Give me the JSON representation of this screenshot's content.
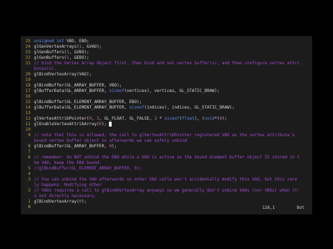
{
  "editor": {
    "lines": [
      {
        "n": "25",
        "t": "unsigned int VBO, EBO;",
        "cls": "code"
      },
      {
        "n": "24",
        "t": "glGenVertexArrays(1, &VAO);",
        "cls": "code"
      },
      {
        "n": "23",
        "t": "glGenBuffers(1, &VBO);",
        "cls": "code"
      },
      {
        "n": "22",
        "t": "glGenBuffers(1, &EBO);",
        "cls": "code"
      },
      {
        "n": "21",
        "t": "// bind the Vertex Array Object first, then bind and set vertex buffer(s), and then configure vertex attri",
        "cls": "comment"
      },
      {
        "n": "",
        "t": "butes(s).",
        "cls": "comment"
      },
      {
        "n": "20",
        "t": "glBindVertexArray(VAO);",
        "cls": "code"
      },
      {
        "n": "19",
        "t": "",
        "cls": "code"
      },
      {
        "n": "18",
        "t": "glBindBuffer(GL_ARRAY_BUFFER, VBO);",
        "cls": "code"
      },
      {
        "n": "17",
        "t": "glBufferData(GL_ARRAY_BUFFER, sizeof(vertices), vertices, GL_STATIC_DRAW);",
        "cls": "code"
      },
      {
        "n": "16",
        "t": "",
        "cls": "code"
      },
      {
        "n": "15",
        "t": "glBindBuffer(GL_ELEMENT_ARRAY_BUFFER, EBO);",
        "cls": "code"
      },
      {
        "n": "14",
        "t": "glBufferData(GL_ELEMENT_ARRAY_BUFFER, sizeof(indices), indices, GL_STATIC_DRAW);",
        "cls": "code"
      },
      {
        "n": "13",
        "t": "",
        "cls": "code"
      },
      {
        "n": "12",
        "t": "glVertexAttribPointer(0, 3, GL_FLOAT, GL_FALSE, 3 * sizeof(float), (void*)0);",
        "cls": "code"
      },
      {
        "n": "11",
        "t": "glEnableVertexAttribArray(0);",
        "cls": "code"
      },
      {
        "n": "10",
        "t": "",
        "cls": "code"
      },
      {
        "n": "9",
        "t": "// note that this is allowed, the call to glVertexAttribPointer registered VBO as the vertex attribute's",
        "cls": "comment"
      },
      {
        "n": "",
        "t": "bound vertex buffer object so afterwards we can safely unbind",
        "cls": "comment"
      },
      {
        "n": "8",
        "t": "glBindBuffer(GL_ARRAY_BUFFER, 0);",
        "cls": "code"
      },
      {
        "n": "7",
        "t": "",
        "cls": "code"
      },
      {
        "n": "6",
        "t": "// remember: do NOT unbind the EBO while a VAO is active as the bound element buffer object IS stored in t",
        "cls": "comment"
      },
      {
        "n": "",
        "t": "he VAO; keep the EBO bound.",
        "cls": "comment"
      },
      {
        "n": "5",
        "t": "//glBindBuffer(GL_ELEMENT_ARRAY_BUFFER, 0);",
        "cls": "comment"
      },
      {
        "n": "4",
        "t": "",
        "cls": "code"
      },
      {
        "n": "3",
        "t": "// You can unbind the VAO afterwards so other VAO calls won't accidentally modify this VAO, but this rare",
        "cls": "comment"
      },
      {
        "n": "",
        "t": "ly happens. Modifying other",
        "cls": "comment"
      },
      {
        "n": "2",
        "t": "// VAOs requires a call to glBindVertexArray anyways so we generally don't unbind VAOs (nor VBOs) when it'",
        "cls": "comment"
      },
      {
        "n": "",
        "t": "s not directly necessary.",
        "cls": "comment"
      },
      {
        "n": "1",
        "t": "glBindVertexArray(0);",
        "cls": "code"
      },
      {
        "n": "0",
        "t": "",
        "cls": "code"
      }
    ],
    "cursor_line_index": 15
  },
  "status": {
    "position": "128,1",
    "scroll": "Bot"
  },
  "colors": {
    "background": "#1c1c1c",
    "line_number": "#d7c34a",
    "comment": "#a64bd6",
    "keyword": "#5f8af0",
    "text": "#d7d7d7"
  }
}
